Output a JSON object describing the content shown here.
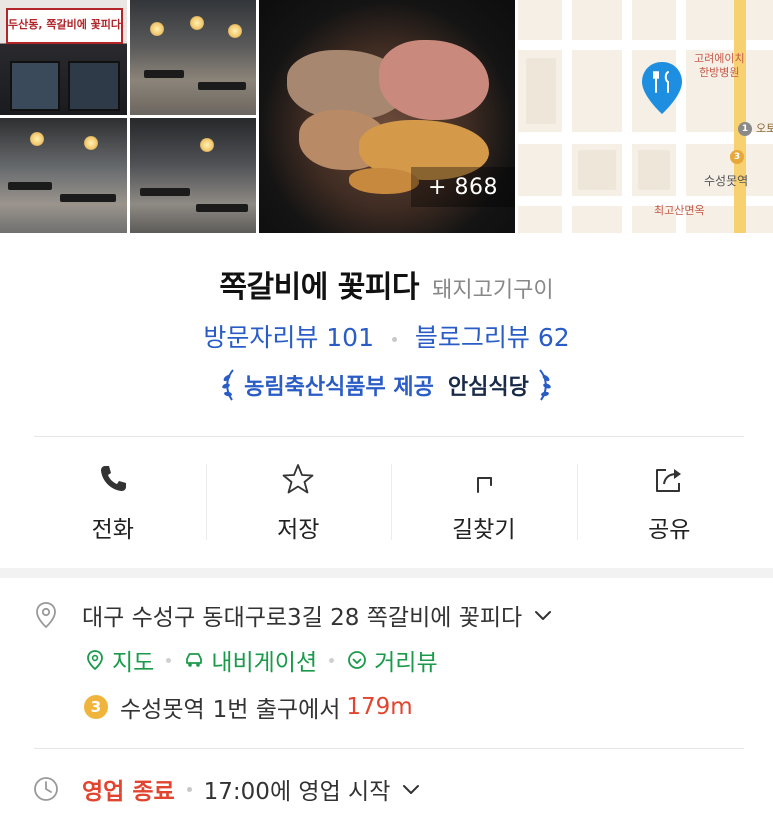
{
  "photos": {
    "storefront_sign": "두산동, 쪽갈비에 꽃피다",
    "more_count": "+ 868",
    "map_labels": {
      "hospital": "고려에이치\n한방병원",
      "station": "수성못역",
      "restaurant": "최고산면옥",
      "road": "오토"
    },
    "map_station_number": "3",
    "map_station_number_2": "1"
  },
  "place": {
    "name": "쪽갈비에 꽃피다",
    "category": "돼지고기구이",
    "visitor_reviews": "방문자리뷰 101",
    "blog_reviews": "블로그리뷰 62",
    "badge_provider": "농림축산식품부 제공",
    "badge_name": "안심식당"
  },
  "actions": [
    {
      "label": "전화",
      "icon": "phone-icon"
    },
    {
      "label": "저장",
      "icon": "star-icon"
    },
    {
      "label": "길찾기",
      "icon": "directions-icon"
    },
    {
      "label": "공유",
      "icon": "share-icon"
    }
  ],
  "info": {
    "address": "대구 수성구 동대구로3길 28 쪽갈비에 꽃피다",
    "links": {
      "map": "지도",
      "navigation": "내비게이션",
      "street_view": "거리뷰"
    },
    "subway": {
      "line": "3",
      "station": "수성못역",
      "exit_text": "1번 출구에서",
      "distance": "179m"
    },
    "hours": {
      "status": "영업 종료",
      "next": "17:00에 영업 시작"
    }
  },
  "colors": {
    "link_blue": "#2a5cc6",
    "green": "#1a9a4a",
    "red": "#e2452f",
    "pin_blue": "#1e8fe0",
    "subway_line3": "#f0b43c"
  }
}
